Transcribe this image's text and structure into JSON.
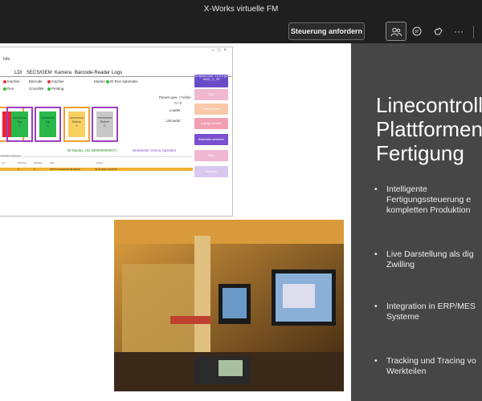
{
  "window": {
    "title": "X-Works virtuelle FM"
  },
  "toolbar": {
    "request_control": "Steuerung anfordern",
    "icons": [
      "participants-icon",
      "chat-icon",
      "reactions-icon",
      "more-icon"
    ]
  },
  "app": {
    "menu_info": "Info",
    "tabs": [
      "LDI",
      "SECS/GEM",
      "Kamera",
      "Barcode-Reader",
      "Logs"
    ],
    "status": {
      "inactive": "Inactive",
      "run": "Run",
      "barcode_label": "Barcode",
      "barcode_state": "Inactive",
      "crosslink_label": "Crosslink",
      "crosslink_state": "Printing",
      "modus_label": "Modus",
      "modus_state": "ID Run automatic"
    },
    "cards": [
      {
        "color": "#f0a030",
        "line1": "",
        "line2": ""
      },
      {
        "color": "#9b40c0",
        "line1": "xxxxxxxxxx",
        "line2": "Top"
      },
      {
        "color": "#9b40c0",
        "line1": "xxxxxxxxxx",
        "line2": "Top"
      },
      {
        "color": "#f0a030",
        "line1": "xxxxxxxxxx",
        "line2": "Bottom"
      },
      {
        "color": "#9b40c0",
        "line1": "xxxxxxxxxx",
        "line2": "Bottom"
      }
    ],
    "panel": {
      "counts_label": "Panels ges. / Fehler",
      "counts_value": "0 / 0",
      "loader": "Loader:",
      "unloader": "Unloader:"
    },
    "mode_text": "ID-Modus: (ID 400000000007)",
    "operator_text": "Bearbeiter: Demo Operator",
    "grid_header": "Auftragsmeldungen",
    "grid_cols": [
      "Lot",
      "Soll Top",
      "Soll Bot",
      "Info",
      "Fertig"
    ],
    "grid_row": [
      "0",
      "0",
      "",
      "IDWTI Auswahl ist ID Modus",
      "01.07.2021 14:00:52"
    ],
    "side_buttons": [
      {
        "label": "ID Works Conf. 1.0.0.0 (ID 1000) _V_ SP",
        "color": "#6a4cc8"
      },
      {
        "label": "Start",
        "color": "#f0b8d0"
      },
      {
        "label": "Unterbrechen",
        "color": "#f8c8a8"
      },
      {
        "label": "Auftrag beenden",
        "color": "#f0a0b0"
      },
      {
        "label": "Bearbeiter wechseln",
        "color": "#7a50d0"
      },
      {
        "label": "Eject",
        "color": "#f0b8d0"
      },
      {
        "label": "Beenden",
        "color": "#d8c8f0"
      }
    ]
  },
  "slide": {
    "title_lines": [
      "Linecontroll",
      "Plattformen",
      "Fertigung"
    ],
    "bullets": [
      [
        "Intelligente",
        "Fertigungssteuerung e",
        "kompletten Produktion"
      ],
      [
        "Live Darstellung als dig",
        "Zwilling"
      ],
      [
        "Integration in ERP/MES",
        "Systeme"
      ],
      [
        "Tracking und Tracing vo",
        "Werkteilen"
      ]
    ]
  }
}
